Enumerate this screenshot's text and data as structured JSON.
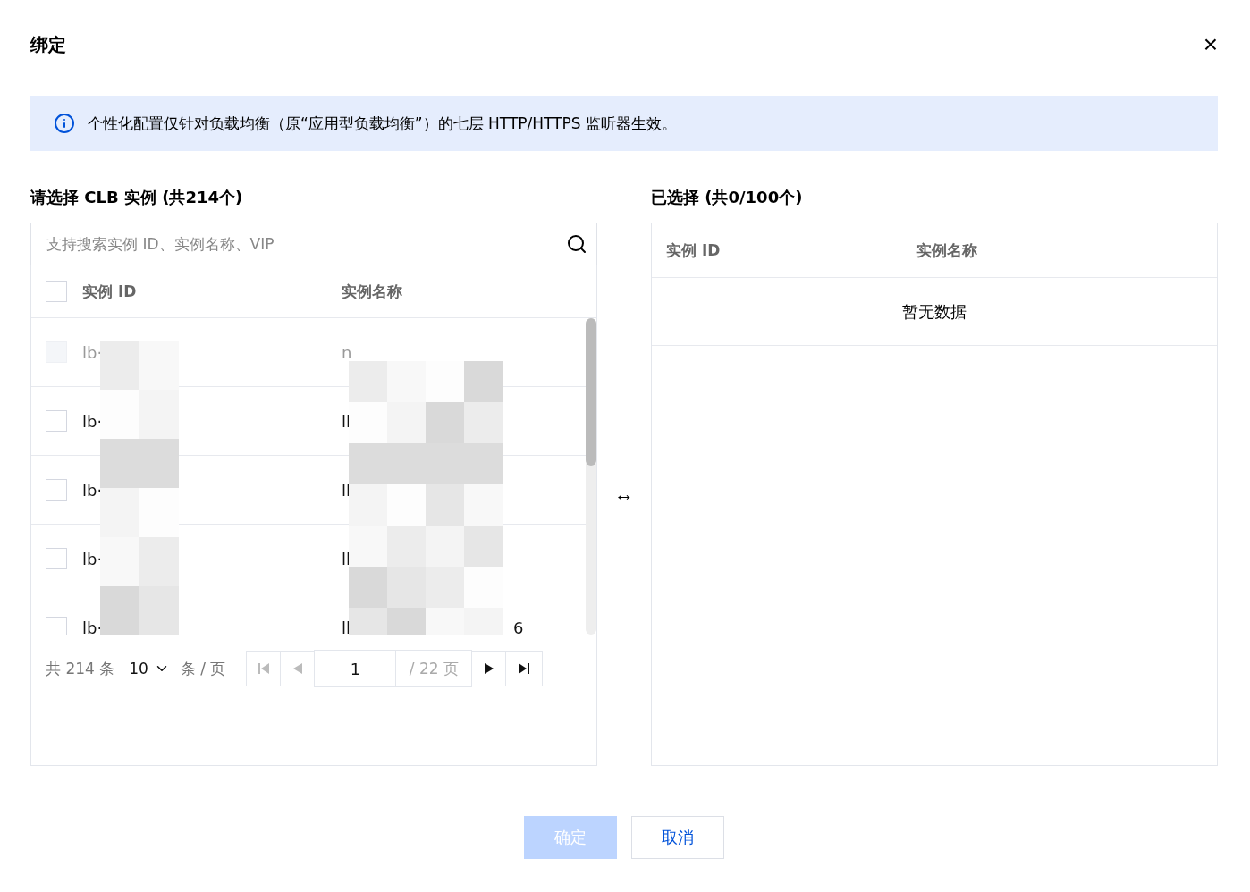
{
  "dialog": {
    "title": "绑定",
    "close": "×"
  },
  "notice": "个性化配置仅针对负载均衡（原“应用型负载均衡”）的七层 HTTP/HTTPS 监听器生效。",
  "left": {
    "heading": "请选择 CLB 实例 (共214个)",
    "search": {
      "placeholder": "支持搜索实例 ID、实例名称、VIP"
    },
    "columns": [
      "实例 ID",
      "实例名称"
    ],
    "all_checked": false,
    "rows": [
      {
        "id": "lb·",
        "name": "n",
        "tail": "",
        "disabled": true,
        "checked": false
      },
      {
        "id": "lb·",
        "name": "ll",
        "tail": "",
        "disabled": false,
        "checked": false
      },
      {
        "id": "lb·",
        "name": "ll",
        "tail": "",
        "disabled": false,
        "checked": false
      },
      {
        "id": "lb·",
        "name": "ll",
        "tail": "",
        "disabled": false,
        "checked": false
      },
      {
        "id": "lb·",
        "name": "ll",
        "tail": "6",
        "disabled": false,
        "checked": false
      }
    ],
    "pagination": {
      "total": "共 214 条",
      "page_size": "10",
      "per_page": "条 / 页",
      "page": "1",
      "pages": "/ 22 页"
    }
  },
  "transfer": "↔",
  "right": {
    "heading": "已选择 (共0/100个)",
    "columns": [
      "实例 ID",
      "实例名称"
    ],
    "empty": "暂无数据"
  },
  "buttons": [
    {
      "label": "确定",
      "disabled": true,
      "kind": "primary"
    },
    {
      "label": "取消",
      "disabled": false,
      "kind": "secondary"
    }
  ]
}
